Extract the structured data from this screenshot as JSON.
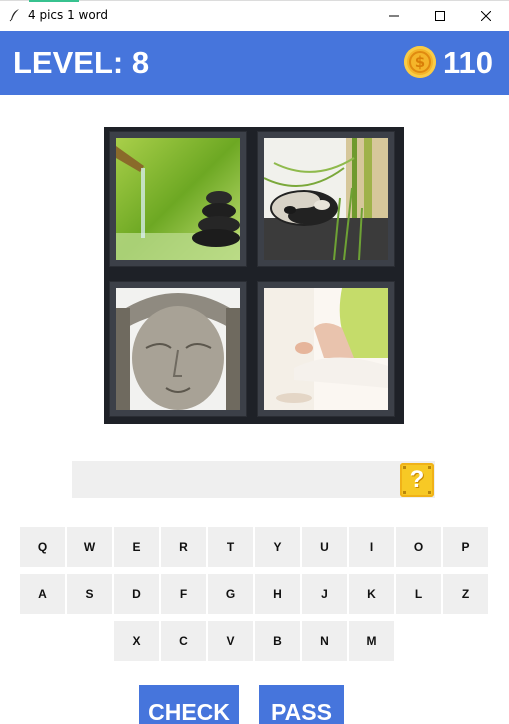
{
  "window": {
    "title": "4 pics 1 word",
    "icon": "feather-icon",
    "controls": [
      "minimize-icon",
      "maximize-icon",
      "close-icon"
    ]
  },
  "header": {
    "level_text": "LEVEL: 8",
    "coins": "110",
    "coin_icon": "dollar-coin-icon",
    "coin_symbol": "$",
    "background": "#4675dc"
  },
  "pictures": [
    {
      "name": "zen-stones-bamboo-fountain"
    },
    {
      "name": "yin-yang-stones-bamboo"
    },
    {
      "name": "buddha-statue-face"
    },
    {
      "name": "meditation-lotus-pose"
    }
  ],
  "answer": {
    "value": "",
    "hint_icon": "question-block-icon",
    "hint_symbol": "?"
  },
  "keyboard": {
    "row1": [
      "Q",
      "W",
      "E",
      "R",
      "T",
      "Y",
      "U",
      "I",
      "O",
      "P"
    ],
    "row2": [
      "A",
      "S",
      "D",
      "F",
      "G",
      "H",
      "J",
      "K",
      "L",
      "Z"
    ],
    "row3": [
      "X",
      "C",
      "V",
      "B",
      "N",
      "M"
    ]
  },
  "actions": {
    "check_label": "CHECK",
    "pass_label": "PASS"
  }
}
